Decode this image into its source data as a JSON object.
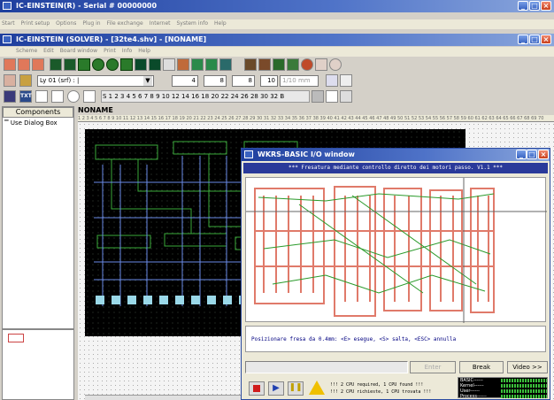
{
  "main_window": {
    "title": "IC-EINSTEIN(R) - Serial # 00000000",
    "menu": [
      "Start",
      "Print setup",
      "Options",
      "Plug in",
      "File exchange",
      "Internet",
      "System info",
      "Help"
    ]
  },
  "doc_window": {
    "title": "IC-EINSTEIN (SOLVER) - [32te4.shv] - [NONAME]",
    "menu": [
      "Scheme",
      "Edit",
      "Board window",
      "Print",
      "Info",
      "Help"
    ]
  },
  "toolbar": {
    "layer_select": "Ly 01 (srf) : |",
    "field_1": "4",
    "field_2": "8",
    "field_3": "8",
    "field_4": "10",
    "unit_field": "1/10 mm",
    "txt_label": "TXT",
    "grid_scale": "S 1 2 3 4 5 6 7 8 9 10 12 14 16 18 20 22 24 26 28 30 32 B"
  },
  "components_panel": {
    "header": "Components",
    "item": "Use Dialog Box"
  },
  "canvas": {
    "tab_label": "NONAME"
  },
  "io_window": {
    "title": "WKRS-BASIC I/O window",
    "header_line": "*** Fresatura mediante controllo diretto dei motori passo. V1.1 ***",
    "prompt_line": "Posizionare fresa da 0.4mm: <E> esegue, <S> salta, <ESC> annulla",
    "enter_button": "Enter",
    "break_button": "Break",
    "video_button": "Video >>",
    "status_line_1": "!!! 2 CPU required, 1 CPU found !!!",
    "status_line_2": "!!! 2 CPU richieste, 1 CPU trovata !!!",
    "meters": [
      "BASIC------",
      "Kernel------",
      "User------",
      "Process------"
    ]
  },
  "colors": {
    "titlebar": "#1f3f9e",
    "trace_green": "#3aaa3a",
    "trace_blue": "#6a8ae8",
    "pad_cyan": "#9ad8e8",
    "milling_red": "#e07a6a",
    "io_text": "#000080"
  }
}
